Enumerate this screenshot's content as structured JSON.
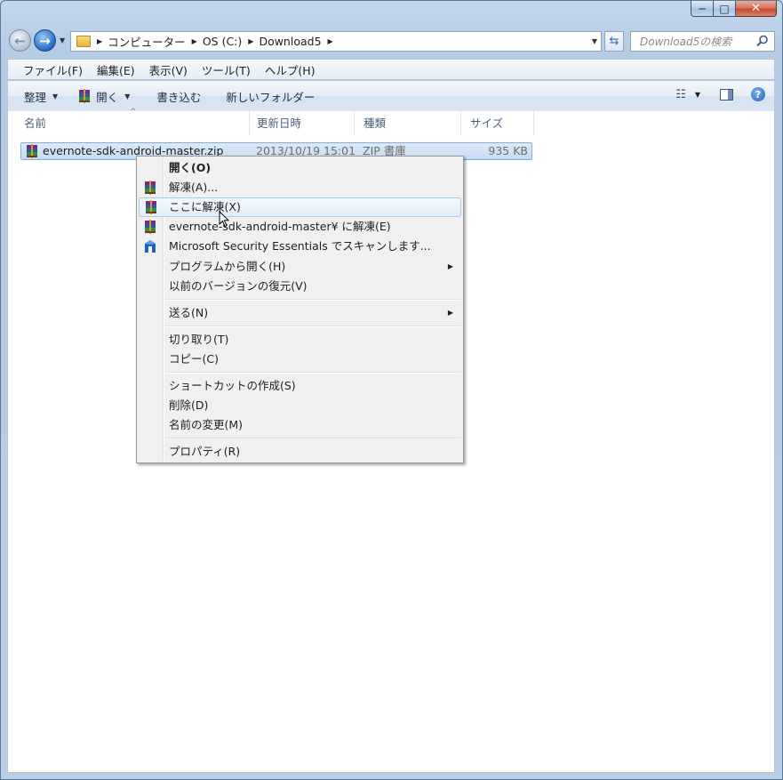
{
  "window": {
    "caption": {
      "minimize": "─",
      "maximize": "□",
      "close": "✕"
    }
  },
  "nav": {
    "breadcrumb": [
      "コンピューター",
      "OS (C:)",
      "Download5"
    ],
    "search_placeholder": "Download5の検索"
  },
  "menubar": [
    "ファイル(F)",
    "編集(E)",
    "表示(V)",
    "ツール(T)",
    "ヘルプ(H)"
  ],
  "toolbar": {
    "organize": "整理",
    "open": "開く",
    "burn": "書き込む",
    "new_folder": "新しいフォルダー"
  },
  "columns": {
    "name": "名前",
    "date": "更新日時",
    "type": "種類",
    "size": "サイズ"
  },
  "files": [
    {
      "name": "evernote-sdk-android-master.zip",
      "date": "2013/10/19 15:01",
      "type": "ZIP 書庫",
      "size": "935 KB"
    }
  ],
  "context_menu": {
    "open": "開く(O)",
    "extract": "解凍(A)...",
    "extract_here": "ここに解凍(X)",
    "extract_to": "evernote-sdk-android-master¥ に解凍(E)",
    "scan": "Microsoft Security Essentials でスキャンします...",
    "open_with": "プログラムから開く(H)",
    "restore": "以前のバージョンの復元(V)",
    "send_to": "送る(N)",
    "cut": "切り取り(T)",
    "copy": "コピー(C)",
    "shortcut": "ショートカットの作成(S)",
    "delete": "削除(D)",
    "rename": "名前の変更(M)",
    "properties": "プロパティ(R)"
  },
  "colors": {
    "selection": "#c6dcf4",
    "highlight_border": "#a8c8ec",
    "frame": "#b9cee6"
  }
}
